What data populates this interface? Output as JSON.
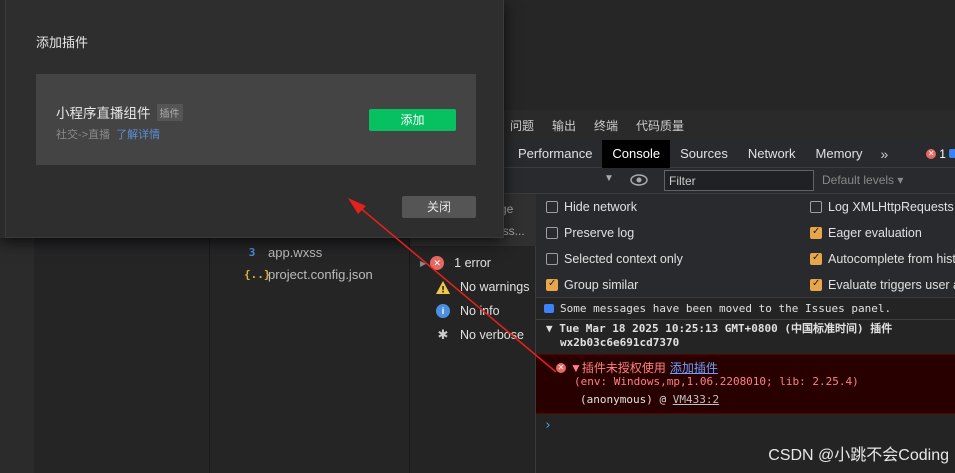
{
  "modal": {
    "title": "添加插件",
    "plugin_name": "小程序直播组件",
    "plugin_tag": "插件",
    "plugin_category": "社交->直播",
    "plugin_more_link": "了解详情",
    "add_button": "添加",
    "close_button": "关闭"
  },
  "ide": {
    "files": [
      {
        "icon": "css-file-icon",
        "name": "app.wxss"
      },
      {
        "icon": "json-file-icon",
        "name": "project.config.json"
      }
    ]
  },
  "panel_tabs": [
    "问题",
    "输出",
    "终端",
    "代码质量"
  ],
  "devtools": {
    "tabs": [
      "Performance",
      "Console",
      "Sources",
      "Network",
      "Memory"
    ],
    "active_tab": "Console",
    "more_tabs": "»",
    "error_count": "1",
    "filter_value": "Filter",
    "default_levels": "Default levels ▾",
    "settings": [
      {
        "label": "Hide network",
        "checked": false
      },
      {
        "label": "Log XMLHttpRequests",
        "checked": false
      },
      {
        "label": "Preserve log",
        "checked": false
      },
      {
        "label": "Eager evaluation",
        "checked": true
      },
      {
        "label": "Selected context only",
        "checked": false
      },
      {
        "label": "Autocomplete from histo",
        "checked": true
      },
      {
        "label": "Group similar",
        "checked": true
      },
      {
        "label": "Evaluate triggers user ac",
        "checked": true
      }
    ],
    "sidebar_partial": [
      "ge",
      "ess..."
    ],
    "sidebar_items": [
      {
        "icon": "error-icon",
        "label": "1 error"
      },
      {
        "icon": "warning-icon",
        "label": "No warnings"
      },
      {
        "icon": "info-icon",
        "label": "No info"
      },
      {
        "icon": "verbose-icon",
        "label": "No verbose"
      }
    ],
    "console": {
      "moved_message": "Some messages have been moved to the Issues panel.",
      "group_header_line1": "▼ Tue Mar 18 2025 10:25:13 GMT+0800 (中国标准时间) 插件",
      "group_header_line2": "wx2b03c6e691cd7370",
      "error_text": "▼插件未授权使用",
      "error_link": "添加插件",
      "error_env": "(env: Windows,mp,1.06.2208010; lib: 2.25.4)",
      "error_trace_prefix": "(anonymous) @ ",
      "error_trace_link": "VM433:2",
      "prompt": "›"
    }
  },
  "colors": {
    "accent_green": "#07c160",
    "error_red": "#e46962",
    "arrow_red": "#e8201b"
  },
  "watermark": "CSDN @小跳不会Coding"
}
